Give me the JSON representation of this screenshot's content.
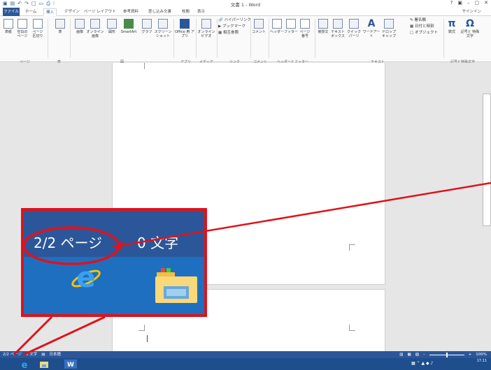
{
  "window": {
    "title": "文書 1 - Word",
    "controls": [
      "?",
      "▣",
      "–",
      "▢",
      "✕"
    ]
  },
  "tabs": [
    {
      "label": "ファイル",
      "active": false
    },
    {
      "label": "ホーム",
      "active": false
    },
    {
      "label": "挿入",
      "active": true
    },
    {
      "label": "デザイン",
      "active": false
    },
    {
      "label": "ページ レイアウト",
      "active": false
    },
    {
      "label": "参考資料",
      "active": false
    },
    {
      "label": "差し込み文書",
      "active": false
    },
    {
      "label": "校閲",
      "active": false
    },
    {
      "label": "表示",
      "active": false
    }
  ],
  "signin": "サインイン",
  "ribbon": {
    "cover": "表紙",
    "blank": "空白の ページ",
    "pagebreak": "ページ 区切り",
    "table": "表",
    "image": "画像",
    "online_image": "オンライン 画像",
    "shapes": "図形",
    "smartart": "SmartArt",
    "graph": "グラフ",
    "screenshot": "スクリーン ショット",
    "office_app": "Office 用 アプリ",
    "online_video": "オンライン ビデオ",
    "hyperlink": "ハイパーリンク",
    "bookmark": "ブックマーク",
    "crossref": "相互参照",
    "comment": "コメント",
    "header": "ヘッダー",
    "footer": "フッター",
    "pagenum": "ページ 番号",
    "greeting": "挨拶文",
    "textbox": "テキスト ボックス",
    "quickparts": "クイック パーツ",
    "wordart": "ワードアート",
    "dropcap": "ドロップ キャップ",
    "signature": "署名欄",
    "datetime": "日付と時刻",
    "object": "オブジェクト",
    "equation_symbol": "π",
    "equation": "数式",
    "symbol_glyph": "Ω",
    "symbol": "記号と 特殊文字",
    "groups": {
      "page": "ページ",
      "table": "表",
      "figure": "図",
      "apps": "アプリ",
      "media": "メディア",
      "link": "リンク",
      "comment": "コメント",
      "headerfooter": "ヘッダーとフッター",
      "text": "テキスト",
      "symbols": "記号と特殊文字"
    }
  },
  "callout": {
    "page_info": "2/2 ページ",
    "word_info": "0 文字"
  },
  "statusbar": {
    "page": "2/2 ページ",
    "words": "0 文字",
    "language": "日本語",
    "zoom": "100%",
    "zoom_fraction": 0.5
  },
  "taskbar": {
    "time": "17:11"
  },
  "colors": {
    "word_blue": "#2b579a",
    "callout_red": "#e0121a"
  }
}
